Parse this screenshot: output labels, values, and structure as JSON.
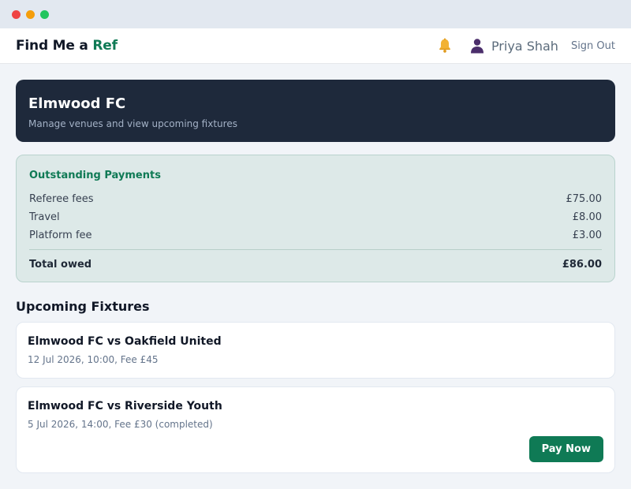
{
  "nav": {
    "brand_main": "Find Me a ",
    "brand_accent": "Ref",
    "user_name": "Priya Shah",
    "sign_out": "Sign Out",
    "bell_icon": "bell-icon",
    "user_icon": "user-icon"
  },
  "hero": {
    "title": "Elmwood FC",
    "subtitle": "Manage venues and view upcoming fixtures"
  },
  "payments": {
    "title": "Outstanding Payments",
    "items": [
      {
        "label": "Referee fees",
        "amount": "£75.00"
      },
      {
        "label": "Travel",
        "amount": "£8.00"
      },
      {
        "label": "Platform fee",
        "amount": "£3.00"
      }
    ],
    "total_label": "Total owed",
    "total_amount": "£86.00"
  },
  "fixtures": {
    "title": "Upcoming Fixtures",
    "items": [
      {
        "title": "Elmwood FC vs Oakfield United",
        "meta": "12 Jul 2026, 10:00, Fee £45"
      },
      {
        "title": "Elmwood FC vs Riverside Youth",
        "meta": "5 Jul 2026, 14:00, Fee £30 (completed)",
        "action": "Pay Now"
      }
    ]
  },
  "colors": {
    "brand_green": "#0f7a55",
    "hero_bg": "#1e293b",
    "payments_bg": "#dde9e8",
    "bell": "#f2b233",
    "user_icon": "#4b2e6b"
  }
}
